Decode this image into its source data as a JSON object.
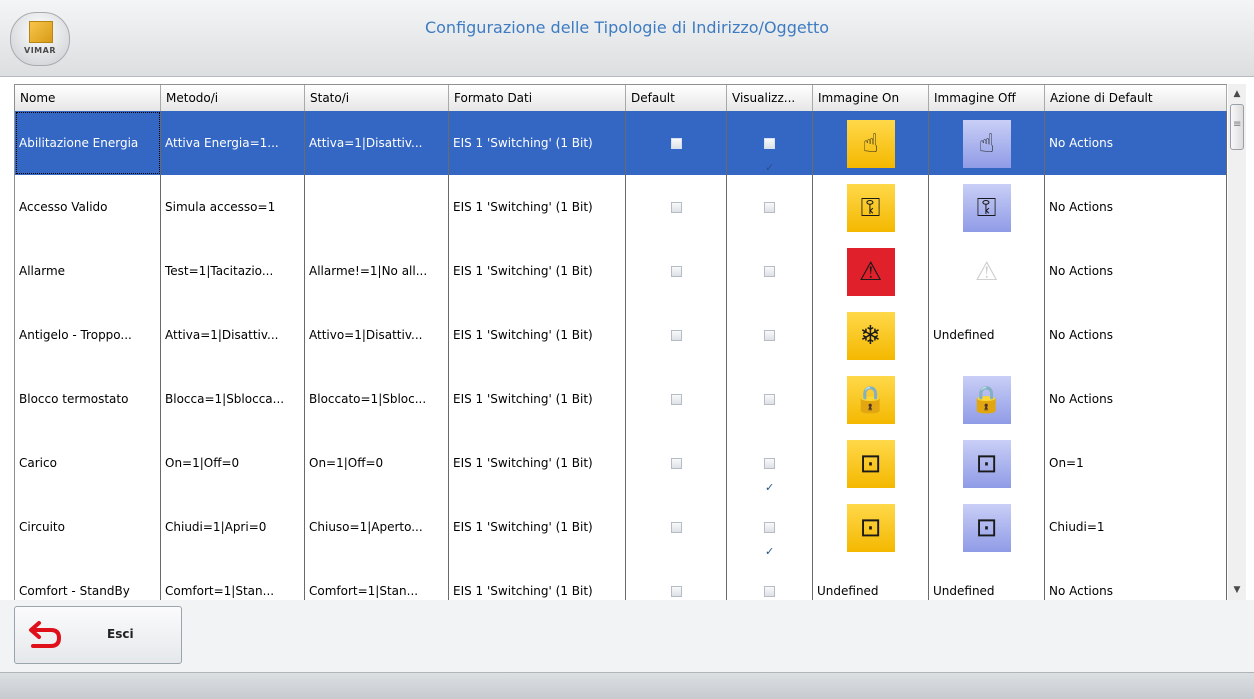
{
  "window": {
    "title": "Configurazione delle Tipologie di Indirizzo/Oggetto",
    "logo_text": "VIMAR"
  },
  "colors": {
    "selection": "#3467c3",
    "image_on": "#f4b800",
    "image_off": "#8f9be6",
    "title": "#3e7cc2"
  },
  "columns": [
    "Nome",
    "Metodo/i",
    "Stato/i",
    "Formato Dati",
    "Default",
    "Visualizz...",
    "Immagine On",
    "Immagine Off",
    "Azione di Default"
  ],
  "rows": [
    {
      "nome": "Abilitazione Energia",
      "metodi": "Attiva Energia=1...",
      "stati": "Attiva=1|Disattiv...",
      "formato": "EIS 1 'Switching' (1 Bit)",
      "default": false,
      "visualizza": true,
      "img_on": "hand-switch-icon",
      "img_off": "hand-switch-icon",
      "img_off_text": "",
      "azione": "No Actions",
      "selected": true
    },
    {
      "nome": "Accesso Valido",
      "metodi": "Simula accesso=1",
      "stati": "",
      "formato": "EIS 1 'Switching' (1 Bit)",
      "default": false,
      "visualizza": false,
      "img_on": "key-icon",
      "img_off": "key-icon",
      "img_off_text": "",
      "azione": "No Actions"
    },
    {
      "nome": "Allarme",
      "metodi": "Test=1|Tacitazio...",
      "stati": "Allarme!=1|No all...",
      "formato": "EIS 1 'Switching' (1 Bit)",
      "default": false,
      "visualizza": false,
      "img_on": "warning-icon",
      "img_off": "warning-icon",
      "img_off_text": "",
      "azione": "No Actions"
    },
    {
      "nome": "Antigelo - Troppo...",
      "metodi": "Attiva=1|Disattiv...",
      "stati": "Attivo=1|Disattiv...",
      "formato": "EIS 1 'Switching' (1 Bit)",
      "default": false,
      "visualizza": false,
      "img_on": "frost-icon",
      "img_off": "",
      "img_off_text": "Undefined",
      "azione": "No Actions"
    },
    {
      "nome": "Blocco termostato",
      "metodi": "Blocca=1|Sblocca...",
      "stati": "Bloccato=1|Sbloc...",
      "formato": "EIS 1 'Switching' (1 Bit)",
      "default": false,
      "visualizza": false,
      "img_on": "padlock-icon",
      "img_off": "padlock-icon",
      "img_off_text": "",
      "azione": "No Actions"
    },
    {
      "nome": "Carico",
      "metodi": "On=1|Off=0",
      "stati": "On=1|Off=0",
      "formato": "EIS 1 'Switching' (1 Bit)",
      "default": false,
      "visualizza": true,
      "img_on": "circuit-icon",
      "img_off": "circuit-icon",
      "img_off_text": "",
      "azione": "On=1"
    },
    {
      "nome": "Circuito",
      "metodi": "Chiudi=1|Apri=0",
      "stati": "Chiuso=1|Aperto...",
      "formato": "EIS 1 'Switching' (1 Bit)",
      "default": false,
      "visualizza": true,
      "img_on": "circuit-icon",
      "img_off": "circuit-icon",
      "img_off_text": "",
      "azione": "Chiudi=1"
    },
    {
      "nome": "Comfort - StandBy",
      "metodi": "Comfort=1|Stan...",
      "stati": "Comfort=1|Stan...",
      "formato": "EIS 1 'Switching' (1 Bit)",
      "default": false,
      "visualizza": false,
      "img_on": "",
      "img_on_text": "Undefined",
      "img_off": "",
      "img_off_text": "Undefined",
      "azione": "No Actions"
    }
  ],
  "buttons": {
    "exit_label": "Esci"
  }
}
